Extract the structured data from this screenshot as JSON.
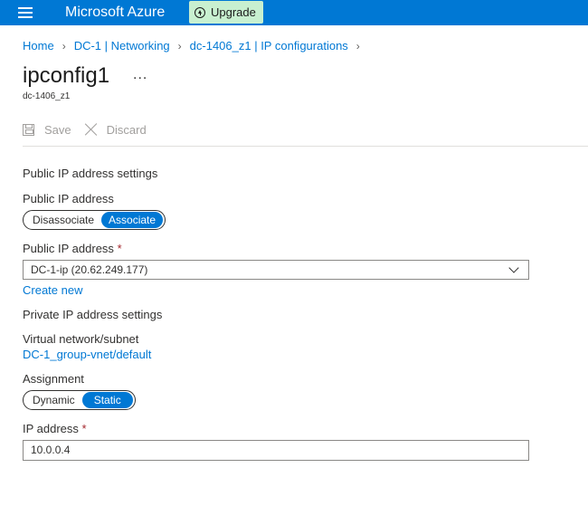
{
  "header": {
    "app_title": "Microsoft Azure",
    "upgrade_label": "Upgrade"
  },
  "breadcrumb": [
    {
      "label": "Home"
    },
    {
      "label": "DC-1 | Networking"
    },
    {
      "label": "dc-1406_z1 | IP configurations"
    }
  ],
  "page": {
    "title": "ipconfig1",
    "more_label": "...",
    "subtitle": "dc-1406_z1"
  },
  "toolbar": {
    "save_label": "Save",
    "discard_label": "Discard"
  },
  "public_ip": {
    "section_title": "Public IP address settings",
    "toggle_label": "Public IP address",
    "toggle_options": [
      "Disassociate",
      "Associate"
    ],
    "toggle_selected": "Associate",
    "select_label": "Public IP address",
    "required_mark": "*",
    "select_value": "DC-1-ip (20.62.249.177)",
    "create_new_label": "Create new"
  },
  "private_ip": {
    "section_title": "Private IP address settings",
    "vnet_label": "Virtual network/subnet",
    "vnet_value": "DC-1_group-vnet/default",
    "assignment_label": "Assignment",
    "assignment_options": [
      "Dynamic",
      "Static"
    ],
    "assignment_selected": "Static",
    "ip_label": "IP address",
    "required_mark": "*",
    "ip_value": "10.0.0.4"
  },
  "colors": {
    "accent": "#0078d4",
    "upgrade_bg": "#c8f0d0",
    "required": "#a4262c"
  },
  "icons": {
    "menu": "hamburger-icon",
    "upgrade": "arrow-up-circle-icon",
    "save": "save-icon",
    "discard": "close-icon",
    "dropdown": "chevron-down-icon"
  }
}
